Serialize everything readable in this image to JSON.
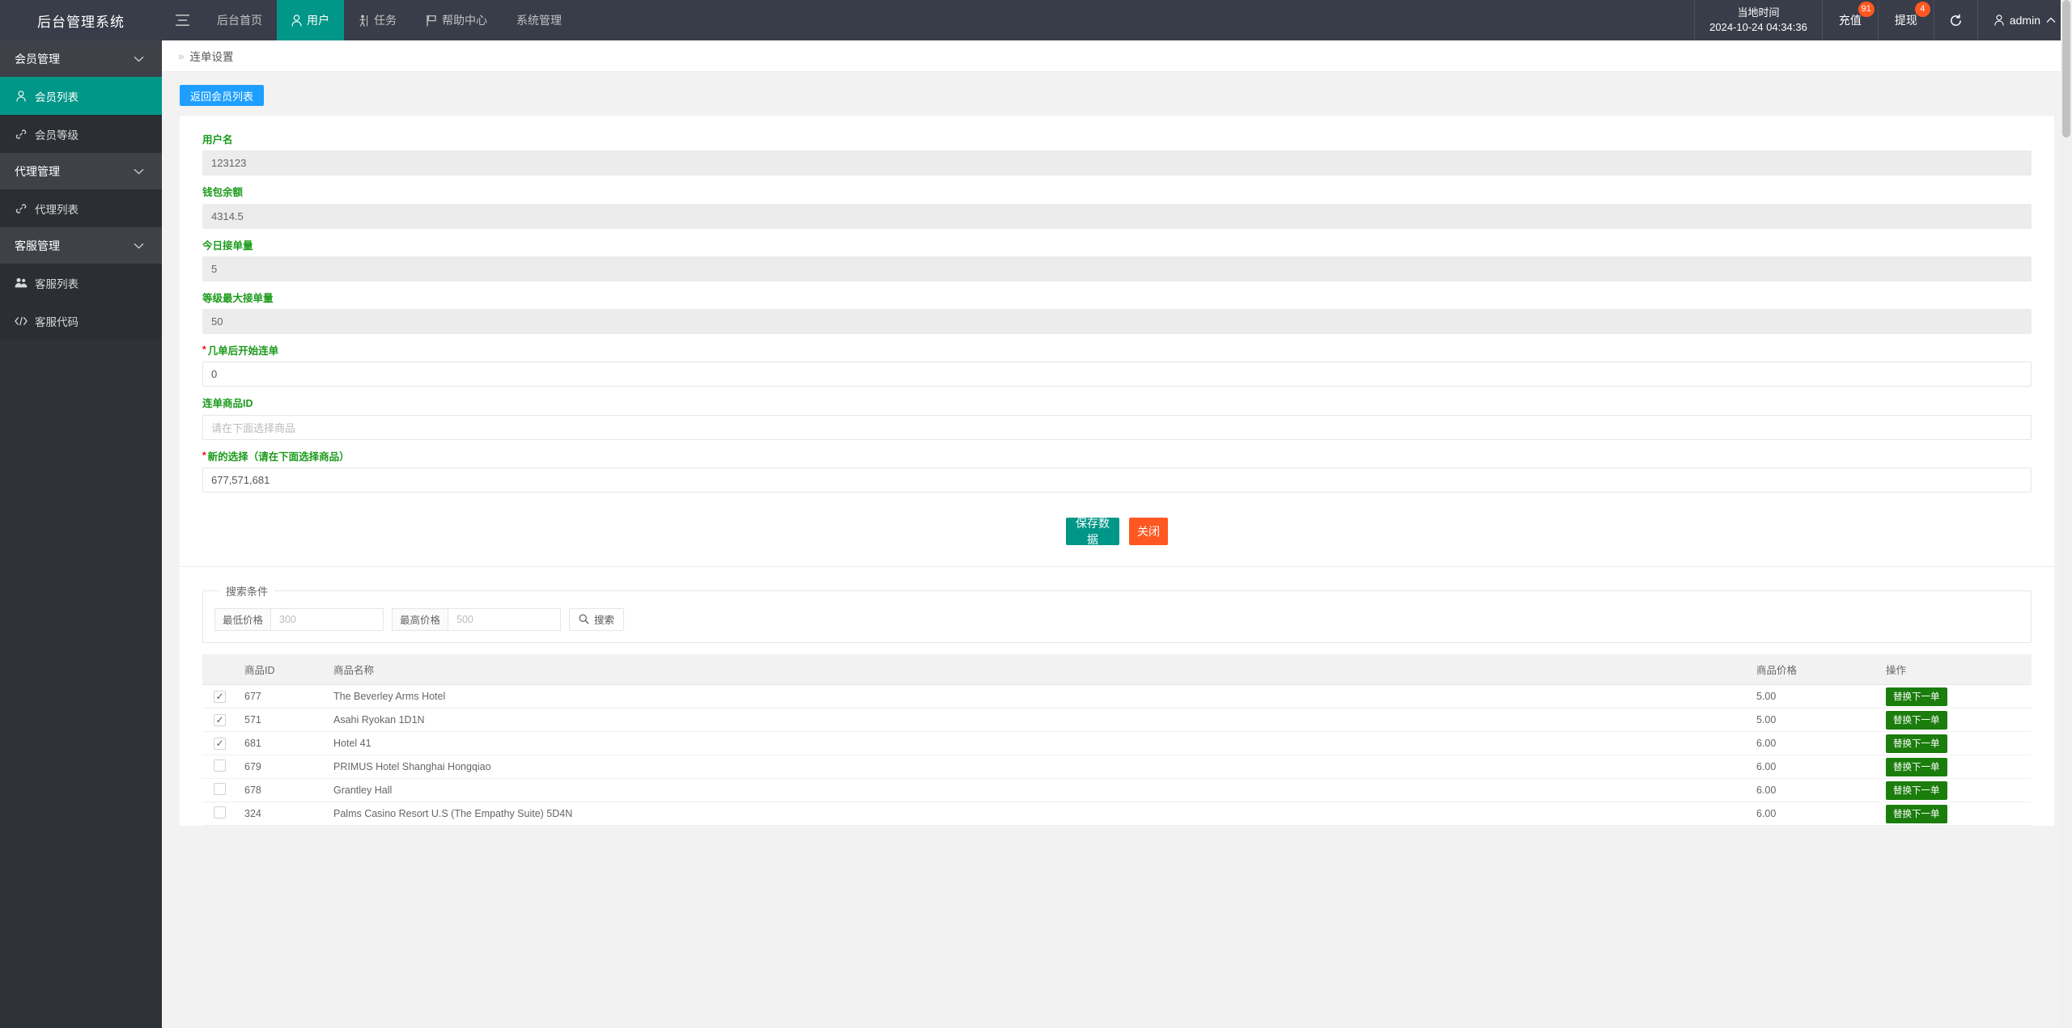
{
  "header": {
    "logo": "后台管理系统",
    "menu_toggle_icon": "hamburger-icon",
    "nav": [
      {
        "label": "后台首页",
        "icon": "",
        "active": false
      },
      {
        "label": "用户",
        "icon": "user-icon",
        "active": true
      },
      {
        "label": "任务",
        "icon": "task-person-icon",
        "active": false
      },
      {
        "label": "帮助中心",
        "icon": "flag-icon",
        "active": false
      },
      {
        "label": "系统管理",
        "icon": "",
        "active": false
      }
    ],
    "local_time_label": "当地时间",
    "local_time_value": "2024-10-24 04:34:36",
    "recharge_label": "充值",
    "recharge_badge": "91",
    "withdraw_label": "提现",
    "withdraw_badge": "4",
    "refresh_icon": "refresh-icon",
    "user_name": "admin",
    "user_caret_icon": "chevron-up-icon"
  },
  "sidebar": {
    "groups": [
      {
        "label": "会员管理",
        "items": [
          {
            "label": "会员列表",
            "icon": "user-icon",
            "active": true
          },
          {
            "label": "会员等级",
            "icon": "link-icon",
            "active": false
          }
        ]
      },
      {
        "label": "代理管理",
        "items": [
          {
            "label": "代理列表",
            "icon": "link-icon",
            "active": false
          }
        ]
      },
      {
        "label": "客服管理",
        "items": [
          {
            "label": "客服列表",
            "icon": "users-icon",
            "active": false
          },
          {
            "label": "客服代码",
            "icon": "code-icon",
            "active": false
          }
        ]
      }
    ]
  },
  "breadcrumb": {
    "separator": "»",
    "current": "连单设置"
  },
  "toolbar": {
    "back_label": "返回会员列表"
  },
  "form": {
    "fields": [
      {
        "label": "用户名",
        "required": false,
        "value": "123123",
        "placeholder": "",
        "readonly": true
      },
      {
        "label": "钱包余额",
        "required": false,
        "value": "4314.5",
        "placeholder": "",
        "readonly": true
      },
      {
        "label": "今日接单量",
        "required": false,
        "value": "5",
        "placeholder": "",
        "readonly": true
      },
      {
        "label": "等级最大接单量",
        "required": false,
        "value": "50",
        "placeholder": "",
        "readonly": true
      },
      {
        "label": "几单后开始连单",
        "required": true,
        "value": "0",
        "placeholder": "",
        "readonly": false
      },
      {
        "label": "连单商品ID",
        "required": false,
        "value": "",
        "placeholder": "请在下面选择商品",
        "readonly": false
      },
      {
        "label": "新的选择（请在下面选择商品）",
        "required": true,
        "value": "677,571,681",
        "placeholder": "",
        "readonly": false
      }
    ],
    "save_label": "保存数据",
    "close_label": "关闭"
  },
  "search": {
    "legend": "搜索条件",
    "min_price_label": "最低价格",
    "min_price_placeholder": "300",
    "min_price_value": "",
    "max_price_label": "最高价格",
    "max_price_placeholder": "500",
    "max_price_value": "",
    "search_button_label": "搜索",
    "search_icon": "magnifier-icon"
  },
  "table": {
    "columns": [
      "",
      "商品ID",
      "商品名称",
      "商品价格",
      "操作"
    ],
    "action_label": "替换下一单",
    "rows": [
      {
        "checked": true,
        "id": "677",
        "name": "The Beverley Arms Hotel",
        "price": "5.00"
      },
      {
        "checked": true,
        "id": "571",
        "name": "Asahi Ryokan 1D1N",
        "price": "5.00"
      },
      {
        "checked": true,
        "id": "681",
        "name": "Hotel 41",
        "price": "6.00"
      },
      {
        "checked": false,
        "id": "679",
        "name": "PRIMUS Hotel Shanghai Hongqiao",
        "price": "6.00"
      },
      {
        "checked": false,
        "id": "678",
        "name": "Grantley Hall",
        "price": "6.00"
      },
      {
        "checked": false,
        "id": "324",
        "name": "Palms Casino Resort U.S (The Empathy Suite) 5D4N",
        "price": "6.00"
      }
    ]
  },
  "colors": {
    "header_bg": "#393D49",
    "sidebar_bg": "#2F3238",
    "accent_teal": "#009688",
    "accent_blue": "#1E9FFF",
    "accent_orange": "#FF5722",
    "label_green": "#1a9b1a",
    "action_green": "#1a7d0c",
    "required_red": "#ff0000"
  }
}
